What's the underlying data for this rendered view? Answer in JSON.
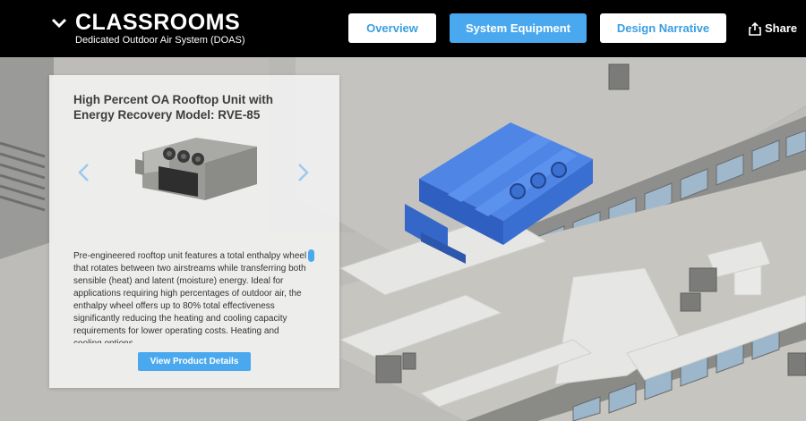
{
  "header": {
    "title": "CLASSROOMS",
    "subtitle": "Dedicated Outdoor Air System (DOAS)",
    "tabs": [
      {
        "label": "Overview",
        "active": false
      },
      {
        "label": "System Equipment",
        "active": true
      },
      {
        "label": "Design Narrative",
        "active": false
      }
    ],
    "share_label": "Share"
  },
  "card": {
    "title": "High Percent OA Rooftop Unit with Energy Recovery Model: RVE-85",
    "description": "Pre-engineered rooftop unit features a total enthalpy wheel that rotates between two airstreams while transferring both sensible (heat) and latent (moisture) energy. Ideal for applications requiring high percentages of outdoor air, the enthalpy wheel offers up to 80% total effectiveness significantly reducing the heating and cooling capacity requirements for lower operating costs. Heating and cooling options",
    "button_label": "View Product Details"
  },
  "colors": {
    "accent": "#4aa9ee",
    "header_bg": "#000000",
    "unit_blue": "#3b6fd0"
  },
  "icons": {
    "collapse": "chevron-down-icon",
    "share": "share-icon",
    "prev": "chevron-left-icon",
    "next": "chevron-right-icon"
  }
}
